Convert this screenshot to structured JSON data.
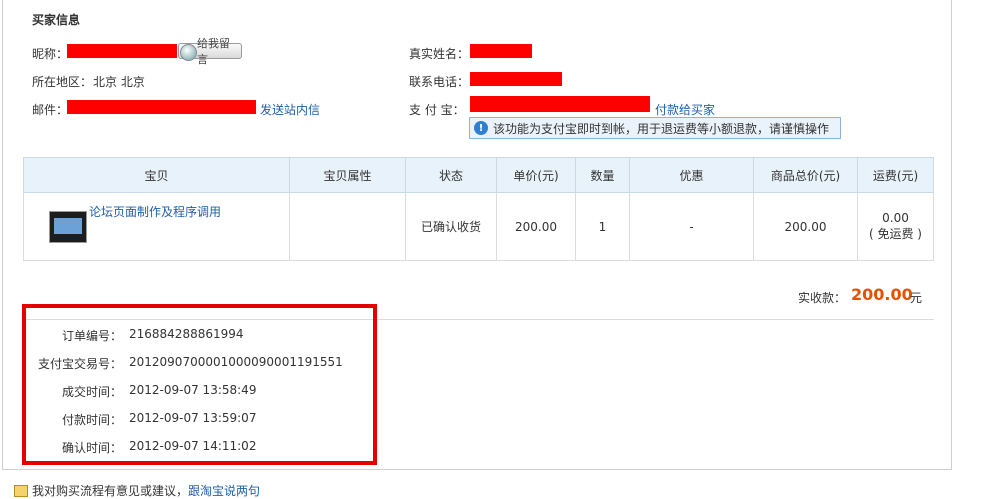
{
  "buyer": {
    "title": "买家信息",
    "nickname_label": "昵称：",
    "msg_button": "给我留言",
    "region_label": "所在地区：",
    "region_value": "北京 北京",
    "email_label": "邮件：",
    "email_link": "发送站内信",
    "realname_label": "真实姓名：",
    "phone_label": "联系电话：",
    "alipay_label": "支 付 宝：",
    "alipay_link": "付款给买家",
    "notice": "该功能为支付宝即时到帐，用于退运费等小额退款，请谨慎操作"
  },
  "table": {
    "headers": [
      "宝贝",
      "宝贝属性",
      "状态",
      "单价(元)",
      "数量",
      "优惠",
      "商品总价(元)",
      "运费(元)"
    ],
    "row": {
      "product": "论坛页面制作及程序调用",
      "attrs": "",
      "status": "已确认收货",
      "price": "200.00",
      "qty": "1",
      "discount": "-",
      "total": "200.00",
      "shipping": "0.00",
      "shipping_note": "( 免运费 )"
    }
  },
  "summary": {
    "label": "实收款：",
    "value": "200.00",
    "unit": "元"
  },
  "order": {
    "order_no_label": "订单编号：",
    "order_no": "216884288861994",
    "trade_no_label": "支付宝交易号：",
    "trade_no": "2012090700001000090001191551",
    "deal_time_label": "成交时间：",
    "deal_time": "2012-09-07 13:58:49",
    "pay_time_label": "付款时间：",
    "pay_time": "2012-09-07 13:59:07",
    "confirm_time_label": "确认时间：",
    "confirm_time": "2012-09-07 14:11:02"
  },
  "footer": {
    "text": "我对购买流程有意见或建议，",
    "link": "跟淘宝说两句"
  },
  "colors": {
    "highlight_box": "#e50000",
    "redaction": "#ff0000",
    "link": "#1f5fa8",
    "total": "#e45200"
  }
}
